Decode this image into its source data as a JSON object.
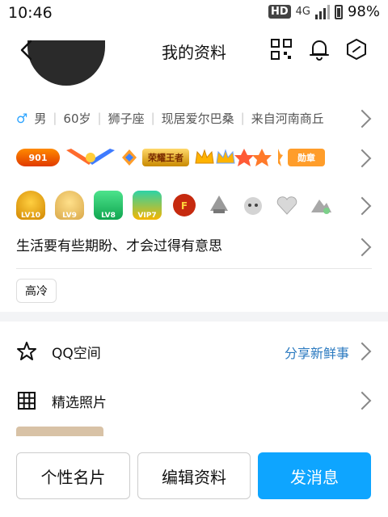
{
  "status": {
    "time": "10:46",
    "hd": "HD",
    "network": "4G",
    "battery": "98%"
  },
  "nav": {
    "title": "我的资料"
  },
  "profile": {
    "gender_symbol": "♂",
    "gender": "男",
    "age": "60岁",
    "zodiac": "狮子座",
    "residence": "现居爱尔巴桑",
    "hometown": "来自河南商丘",
    "signature": "生活要有些期盼、才会过得有意思",
    "tag": "高冷"
  },
  "badges": {
    "level_num": "901",
    "king_label": "荣耀王者",
    "medal_label": "勋章"
  },
  "icons2": {
    "lv10": "LV10",
    "lv9": "LV9",
    "lv8": "LV8",
    "vip": "VIP7"
  },
  "menu": {
    "qzone_label": "QQ空间",
    "qzone_action": "分享新鲜事",
    "photos_label": "精选照片"
  },
  "buttons": {
    "card": "个性名片",
    "edit": "编辑资料",
    "message": "发消息"
  },
  "colors": {
    "primary": "#0ea5ff",
    "link": "#2b7ac0",
    "male": "#2aa3ff"
  }
}
